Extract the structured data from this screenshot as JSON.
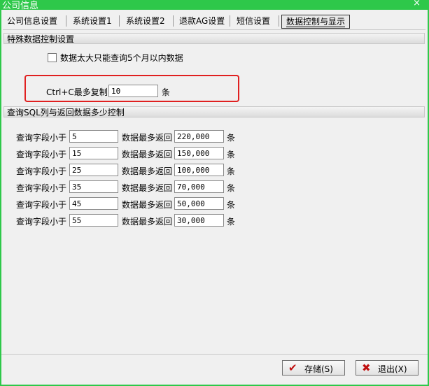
{
  "window": {
    "title": "公司信息",
    "close_glyph": "×"
  },
  "tabs": [
    {
      "label": "公司信息设置"
    },
    {
      "label": "系统设置1"
    },
    {
      "label": "系统设置2"
    },
    {
      "label": "退款AG设置"
    },
    {
      "label": "短信设置"
    },
    {
      "label": "数据控制与显示"
    }
  ],
  "section1": {
    "header": "特殊数据控制设置",
    "checkbox_label": "数据太大只能查询5个月以内数据",
    "checkbox_checked": false,
    "copy_label": "Ctrl+C最多复制",
    "copy_value": "10",
    "copy_unit": "条"
  },
  "section2": {
    "header": "查询SQL列与返回数据多少控制",
    "field_label": "查询字段小于",
    "return_label": "数据最多返回",
    "unit": "条",
    "rows": [
      {
        "fields": "5",
        "max": "220,000"
      },
      {
        "fields": "15",
        "max": "150,000"
      },
      {
        "fields": "25",
        "max": "100,000"
      },
      {
        "fields": "35",
        "max": "70,000"
      },
      {
        "fields": "45",
        "max": "50,000"
      },
      {
        "fields": "55",
        "max": "30,000"
      }
    ]
  },
  "buttons": {
    "save": "存储(S)",
    "exit": "退出(X)"
  },
  "colors": {
    "titlebar": "#2ec84a",
    "highlight": "#e02020"
  }
}
